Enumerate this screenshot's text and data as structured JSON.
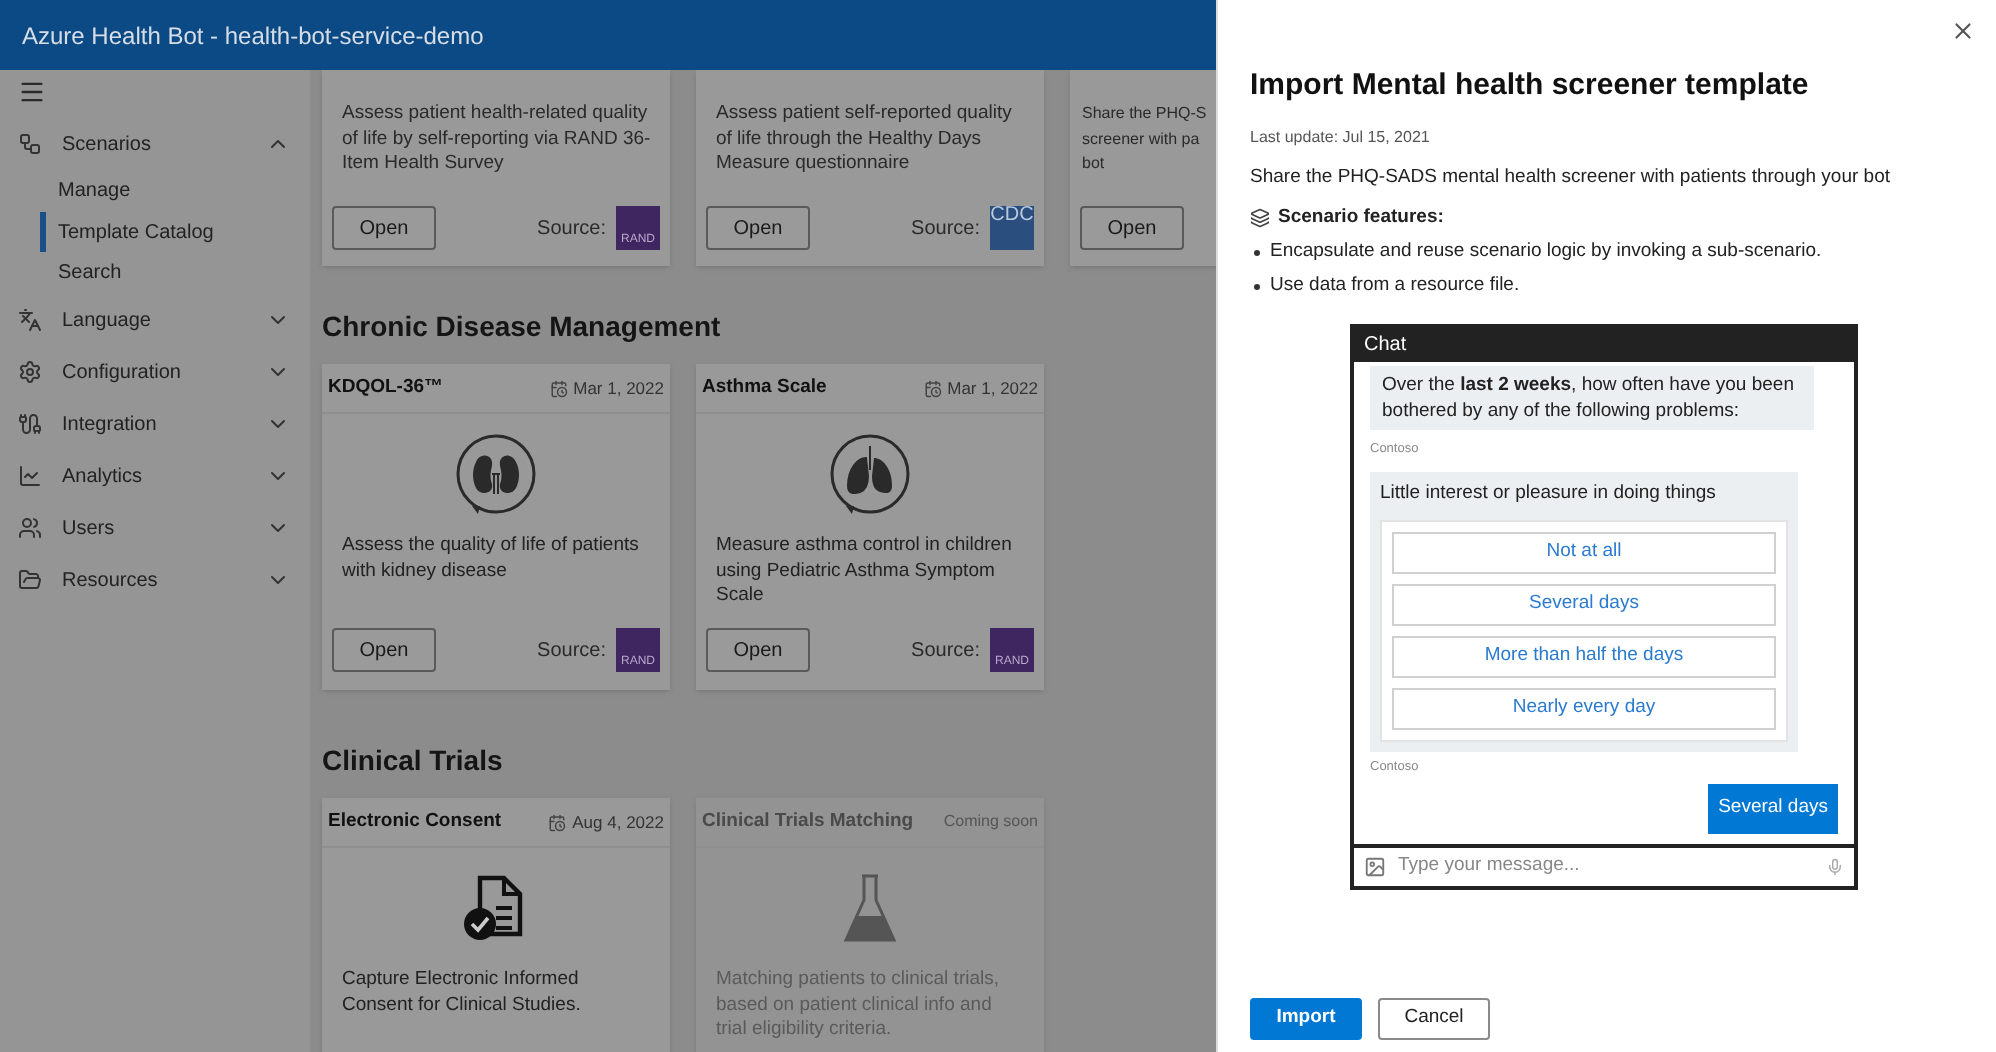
{
  "app_bar": {
    "title": "Azure Health Bot - health-bot-service-demo"
  },
  "sidebar": {
    "items": [
      {
        "label": "Scenarios",
        "expanded": true,
        "children": [
          {
            "label": "Manage",
            "selected": false
          },
          {
            "label": "Template Catalog",
            "selected": true
          },
          {
            "label": "Search",
            "selected": false
          }
        ]
      },
      {
        "label": "Language",
        "expanded": false
      },
      {
        "label": "Configuration",
        "expanded": false
      },
      {
        "label": "Integration",
        "expanded": false
      },
      {
        "label": "Analytics",
        "expanded": false
      },
      {
        "label": "Users",
        "expanded": false
      },
      {
        "label": "Resources",
        "expanded": false
      }
    ]
  },
  "catalog": {
    "top_cards": [
      {
        "description_lines": [
          "Assess patient health-related quality",
          "of life by self-reporting via RAND 36-",
          "Item Health Survey"
        ],
        "button": "Open",
        "source_label": "Source:",
        "source_logo": {
          "kind": "rand",
          "text": "RAND"
        }
      },
      {
        "description_lines": [
          "Assess patient self-reported quality",
          "of life through the Healthy Days",
          "Measure questionnaire"
        ],
        "button": "Open",
        "source_label": "Source:",
        "source_logo": {
          "kind": "cdc",
          "text": "CDC"
        }
      },
      {
        "description_lines": [
          "Share the PHQ-S",
          "screener with pa",
          "bot"
        ],
        "button": "Open"
      }
    ],
    "sections": [
      {
        "title": "Chronic Disease Management",
        "cards": [
          {
            "title": "KDQOL-36™",
            "date": "Mar 1, 2022",
            "disabled": false,
            "description": "Assess the quality of life of patients with kidney disease",
            "button": "Open",
            "source_label": "Source:",
            "source_logo": {
              "kind": "rand",
              "text": "RAND"
            }
          },
          {
            "title": "Asthma Scale",
            "date": "Mar 1, 2022",
            "disabled": false,
            "description": "Measure asthma control in children using Pediatric Asthma Symptom Scale",
            "button": "Open",
            "source_label": "Source:",
            "source_logo": {
              "kind": "rand",
              "text": "RAND"
            }
          }
        ]
      },
      {
        "title": "Clinical Trials",
        "cards": [
          {
            "title": "Electronic Consent",
            "date": "Aug 4, 2022",
            "disabled": false,
            "description": "Capture Electronic Informed Consent for Clinical Studies."
          },
          {
            "title": "Clinical Trials Matching",
            "status": "Coming soon",
            "disabled": true,
            "description": "Matching patients to clinical trials, based on patient clinical info and trial eligibility criteria."
          }
        ]
      }
    ]
  },
  "panel": {
    "title": "Import Mental health screener template",
    "last_update": "Last update: Jul 15, 2021",
    "description": "Share the PHQ-SADS mental health screener with patients through your bot",
    "features_title": "Scenario features:",
    "features": [
      "Encapsulate and reuse scenario logic by invoking a sub-scenario.",
      "Use data from a resource file."
    ],
    "chat": {
      "title": "Chat",
      "bot_message": "Over the **last 2 weeks**, how often have you been bothered by any of the following problems:",
      "sender_1": "Contoso",
      "question": "Little interest or pleasure in doing things",
      "options": [
        "Not at all",
        "Several days",
        "More than half the days",
        "Nearly every day"
      ],
      "sender_2": "Contoso",
      "user_message": "Several days",
      "input_placeholder": "Type your message..."
    },
    "buttons": [
      {
        "label": "Import",
        "kind": "primary"
      },
      {
        "label": "Cancel",
        "kind": "secondary"
      }
    ]
  }
}
